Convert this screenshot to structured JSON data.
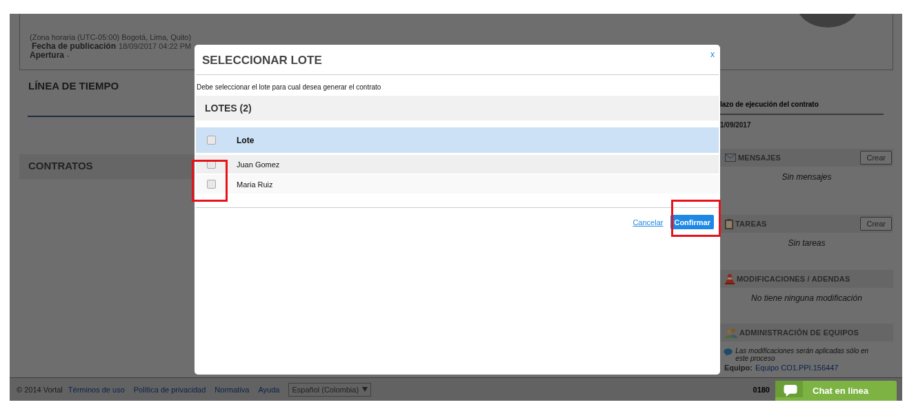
{
  "page": {
    "timezone": "(Zona horaria (UTC-05:00) Bogotá, Lima, Quito)",
    "publication": {
      "label": "Fecha de publicación",
      "value": "18/09/2017 04:22 PM"
    },
    "opening": {
      "label": "Apertura",
      "value": "-"
    }
  },
  "timeline": {
    "title": "LÍNEA DE TIEMPO",
    "column_label": "lazo de ejecución del contrato",
    "date": "1/09/2017"
  },
  "contracts": {
    "title": "CONTRATOS"
  },
  "side_panels": [
    {
      "kind": "messages",
      "title": "MENSAJES",
      "button": "Crear",
      "empty": "Sin mensajes"
    },
    {
      "kind": "tasks",
      "title": "TAREAS",
      "button": "Crear",
      "empty": "Sin tareas"
    },
    {
      "kind": "modifications",
      "title": "MODIFICACIONES / ADENDAS",
      "empty": "No tiene ninguna modificación"
    },
    {
      "kind": "teams",
      "title": "ADMINISTRACIÓN DE EQUIPOS",
      "note": "Las modificaciones serán aplicadas sólo en este proceso",
      "team_label": "Equipo:",
      "team_link": "Equipo CO1.PPI.156447"
    }
  ],
  "footer": {
    "copyright": "© 2014 Vortal",
    "links": [
      "Términos de uso",
      "Política de privacidad",
      "Normativa",
      "Ayuda"
    ],
    "language": "Español (Colombia)",
    "phone": "0180"
  },
  "chat": {
    "label": "Chat en linea"
  },
  "dialog": {
    "title": "SELECCIONAR LOTE",
    "close": "x",
    "instruction": "Debe seleccionar el lote para cual desea generar el contrato",
    "section_title": "LOTES (2)",
    "header": {
      "label": "Lote",
      "checked": false
    },
    "rows": [
      {
        "name": "Juan Gomez",
        "checked": false
      },
      {
        "name": "Maria Ruiz",
        "checked": false
      }
    ],
    "cancel": "Cancelar",
    "confirm": "Confirmar"
  }
}
